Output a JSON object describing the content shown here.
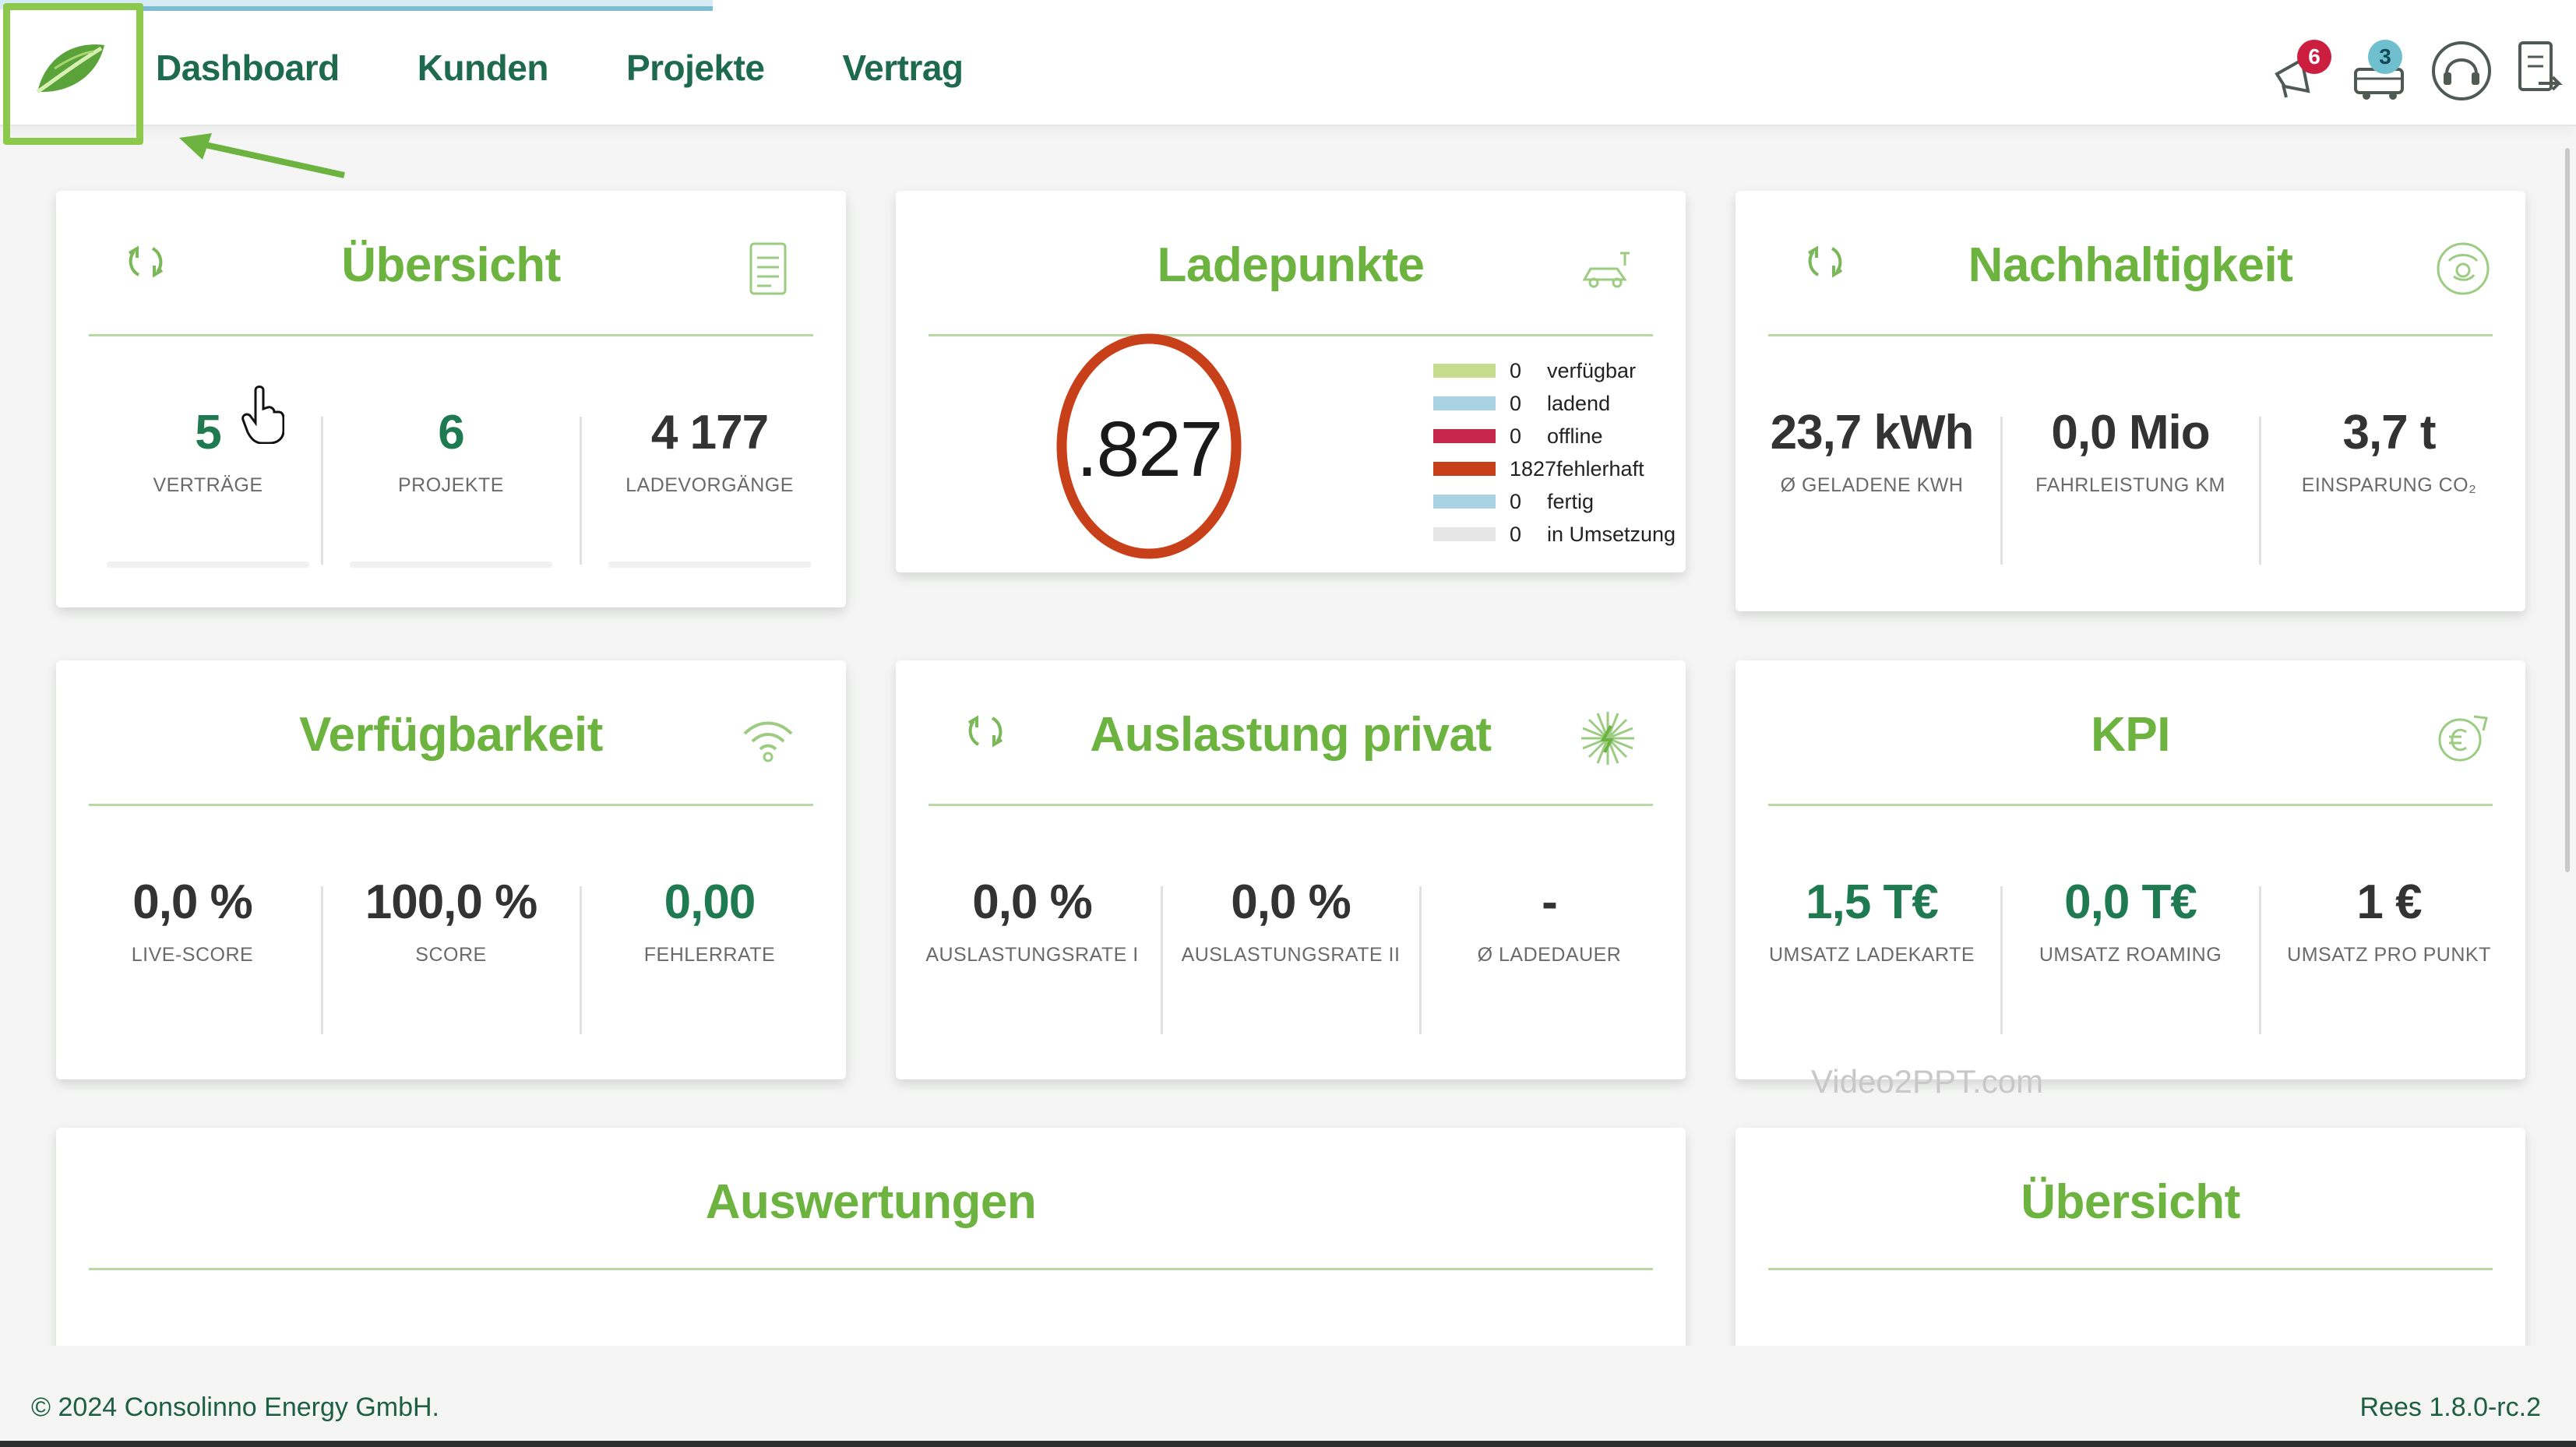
{
  "nav": {
    "items": [
      "Dashboard",
      "Kunden",
      "Projekte",
      "Vertrag"
    ]
  },
  "header": {
    "notifications_badge": "6",
    "messages_badge": "3"
  },
  "cards": {
    "uebersicht": {
      "title": "Übersicht",
      "stats": [
        {
          "value": "5",
          "label": "VERTRÄGE"
        },
        {
          "value": "6",
          "label": "PROJEKTE"
        },
        {
          "value": "4 177",
          "label": "LADEVORGÄNGE"
        }
      ]
    },
    "ladepunkte": {
      "title": "Ladepunkte",
      "total": ".827",
      "legend": [
        {
          "count": "0",
          "label": "verfügbar",
          "color": "#c5dc8e"
        },
        {
          "count": "0",
          "label": "ladend",
          "color": "#a9d3e3"
        },
        {
          "count": "0",
          "label": "offline",
          "color": "#c8254a"
        },
        {
          "count": "1827",
          "label": "fehlerhaft",
          "color": "#c8401a"
        },
        {
          "count": "0",
          "label": "fertig",
          "color": "#a9d3e3"
        },
        {
          "count": "0",
          "label": "in Umsetzung",
          "color": "#e6e6e6"
        }
      ]
    },
    "nachhaltigkeit": {
      "title": "Nachhaltigkeit",
      "stats": [
        {
          "value": "23,7 kWh",
          "label": "Ø GELADENE KWH"
        },
        {
          "value": "0,0 Mio",
          "label": "FAHRLEISTUNG KM"
        },
        {
          "value": "3,7 t",
          "label": "EINSPARUNG CO₂"
        }
      ]
    },
    "verfuegbarkeit": {
      "title": "Verfügbarkeit",
      "stats": [
        {
          "value": "0,0 %",
          "label": "LIVE-SCORE"
        },
        {
          "value": "100,0 %",
          "label": "SCORE"
        },
        {
          "value": "0,00",
          "label": "FEHLERRATE"
        }
      ]
    },
    "auslastung": {
      "title": "Auslastung privat",
      "stats": [
        {
          "value": "0,0 %",
          "label": "AUSLASTUNGSRATE I"
        },
        {
          "value": "0,0 %",
          "label": "AUSLASTUNGSRATE II"
        },
        {
          "value": "-",
          "label": "Ø LADEDAUER"
        }
      ]
    },
    "kpi": {
      "title": "KPI",
      "stats": [
        {
          "value": "1,5 T€",
          "label": "UMSATZ LADEKARTE"
        },
        {
          "value": "0,0 T€",
          "label": "UMSATZ ROAMING"
        },
        {
          "value": "1 €",
          "label": "UMSATZ PRO PUNKT"
        }
      ]
    },
    "auswertungen": {
      "title": "Auswertungen"
    },
    "uebersicht2": {
      "title": "Übersicht"
    }
  },
  "watermark": "Video2PPT.com",
  "footer": {
    "copyright": "© 2024 Consolinno Energy GmbH.",
    "version": "Rees 1.8.0-rc.2"
  },
  "colors": {
    "accent_green": "#6cb33f",
    "dark_green": "#1e6a4f",
    "highlight": "#8cc84b",
    "donut_red": "#c8401a"
  }
}
